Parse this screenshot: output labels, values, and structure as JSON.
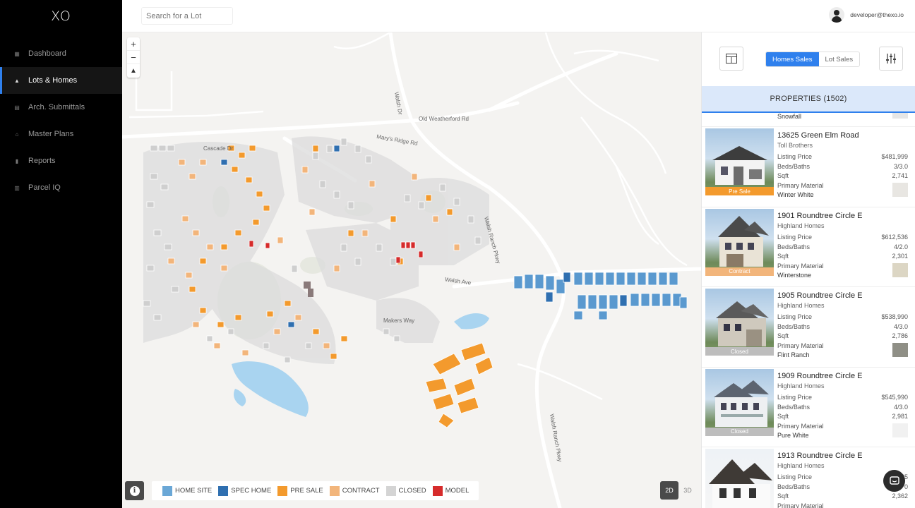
{
  "app": {
    "logo": "XO"
  },
  "sidebar": {
    "items": [
      {
        "label": "Dashboard",
        "icon": "grid-icon",
        "glyph": "▦",
        "active": false
      },
      {
        "label": "Lots & Homes",
        "icon": "triangle-icon",
        "glyph": "▲",
        "active": true
      },
      {
        "label": "Arch. Submittals",
        "icon": "document-icon",
        "glyph": "▤",
        "active": false
      },
      {
        "label": "Master Plans",
        "icon": "home-icon",
        "glyph": "⌂",
        "active": false
      },
      {
        "label": "Reports",
        "icon": "report-icon",
        "glyph": "▮",
        "active": false
      },
      {
        "label": "Parcel IQ",
        "icon": "parcel-icon",
        "glyph": "▥",
        "active": false
      }
    ]
  },
  "topbar": {
    "search_placeholder": "Search for a Lot",
    "user_email": "developer@thexo.io"
  },
  "map": {
    "zoom_in": "+",
    "zoom_out": "−",
    "reset_north": "▲",
    "labels": {
      "old_weatherford": "Old Weatherford Rd",
      "walsh_dr": "Walsh Dr",
      "marys_ridge": "Mary's Ridge Rd",
      "walsh_ranch_pkwy": "Walsh Ranch Pkwy",
      "walsh_ranch_pkwy_south": "Walsh Ranch Pkwy",
      "walsh_ave": "Walsh Ave",
      "makers_way": "Makers Way",
      "cascade": "Cascade Dr"
    },
    "legend": [
      {
        "label": "HOME SITE",
        "color": "#6aa7d6"
      },
      {
        "label": "SPEC HOME",
        "color": "#2f6fb0"
      },
      {
        "label": "PRE SALE",
        "color": "#f39a2d"
      },
      {
        "label": "CONTRACT",
        "color": "#f2b57b"
      },
      {
        "label": "CLOSED",
        "color": "#d4d4d4"
      },
      {
        "label": "MODEL",
        "color": "#d62b2b"
      }
    ],
    "view_toggle": {
      "mode_2d": "2D",
      "mode_3d": "3D"
    }
  },
  "panel": {
    "tabs": [
      "Homes Sales",
      "Lot Sales"
    ],
    "active_tab": "Homes Sales",
    "properties_header": "PROPERTIES (1502)",
    "partial_top_material": "Snowfall",
    "cards": [
      {
        "address": "13625 Green Elm Road",
        "builder": "Toll Brothers",
        "status": "Pre Sale",
        "status_color": "#f39a2d",
        "listing_price_label": "Listing Price",
        "listing_price": "$481,999",
        "beds_baths_label": "Beds/Baths",
        "beds_baths": "3/3.0",
        "sqft_label": "Sqft",
        "sqft": "2,741",
        "material_label": "Primary Material",
        "material": "Winter White",
        "material_color": "#e8e6e2"
      },
      {
        "address": "1901 Roundtree Circle E",
        "builder": "Highland Homes",
        "status": "Contract",
        "status_color": "#f2b57b",
        "listing_price_label": "Listing Price",
        "listing_price": "$612,536",
        "beds_baths_label": "Beds/Baths",
        "beds_baths": "4/2.0",
        "sqft_label": "Sqft",
        "sqft": "2,301",
        "material_label": "Primary Material",
        "material": "Winterstone",
        "material_color": "#dcd6c4"
      },
      {
        "address": "1905 Roundtree Circle E",
        "builder": "Highland Homes",
        "status": "Closed",
        "status_color": "#bdbdbd",
        "listing_price_label": "Listing Price",
        "listing_price": "$538,990",
        "beds_baths_label": "Beds/Baths",
        "beds_baths": "4/3.0",
        "sqft_label": "Sqft",
        "sqft": "2,786",
        "material_label": "Primary Material",
        "material": "Flint Ranch",
        "material_color": "#8f8f86"
      },
      {
        "address": "1909 Roundtree Circle E",
        "builder": "Highland Homes",
        "status": "Closed",
        "status_color": "#bdbdbd",
        "listing_price_label": "Listing Price",
        "listing_price": "$545,990",
        "beds_baths_label": "Beds/Baths",
        "beds_baths": "4/3.0",
        "sqft_label": "Sqft",
        "sqft": "2,981",
        "material_label": "Primary Material",
        "material": "Pure White",
        "material_color": "#f1f1f1"
      },
      {
        "address": "1913 Roundtree Circle E",
        "builder": "Highland Homes",
        "status": "",
        "status_color": "#bdbdbd",
        "listing_price_label": "Listing Price",
        "listing_price": "$5",
        "beds_baths_label": "Beds/Baths",
        "beds_baths": "0",
        "sqft_label": "Sqft",
        "sqft": "2,362",
        "material_label": "Primary Material",
        "material": "",
        "material_color": "#e6e6e6"
      }
    ]
  }
}
